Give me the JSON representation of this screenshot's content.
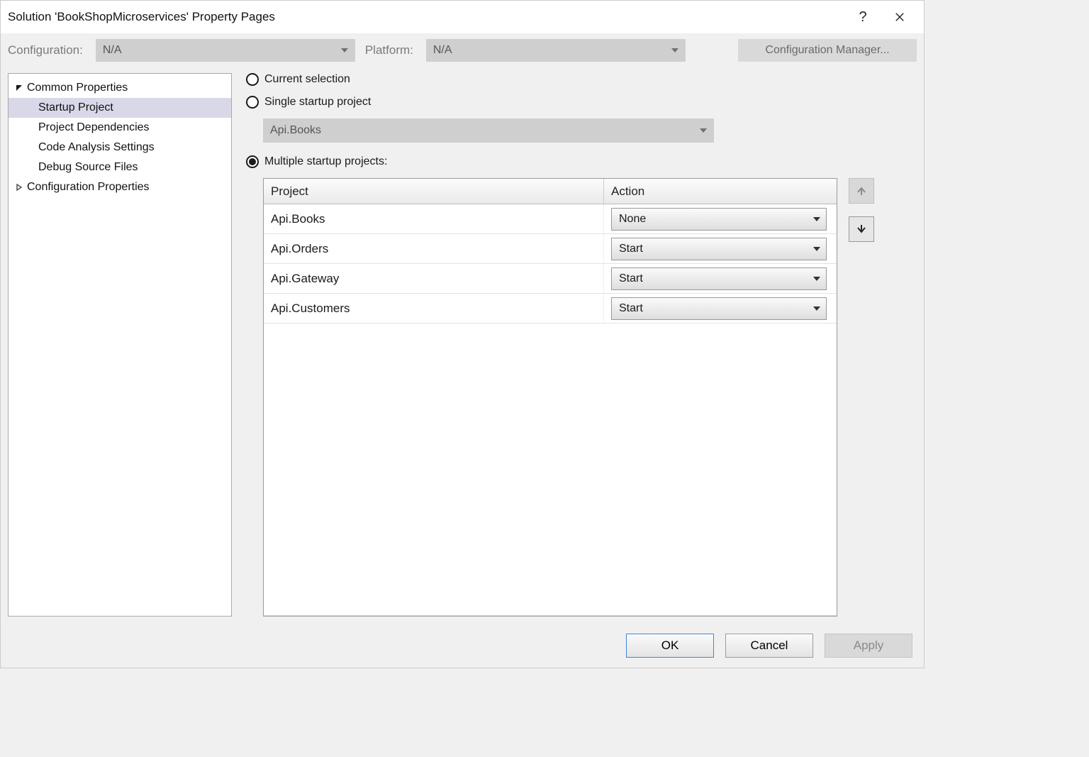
{
  "window": {
    "title": "Solution 'BookShopMicroservices' Property Pages"
  },
  "configRow": {
    "configLabel": "Configuration:",
    "configValue": "N/A",
    "platformLabel": "Platform:",
    "platformValue": "N/A",
    "managerButton": "Configuration Manager..."
  },
  "tree": {
    "root1": "Common Properties",
    "root1_children": [
      "Startup Project",
      "Project Dependencies",
      "Code Analysis Settings",
      "Debug Source Files"
    ],
    "root2": "Configuration Properties"
  },
  "content": {
    "radio_current": "Current selection",
    "radio_single": "Single startup project",
    "single_value": "Api.Books",
    "radio_multiple": "Multiple startup projects:",
    "grid": {
      "header_project": "Project",
      "header_action": "Action",
      "rows": [
        {
          "project": "Api.Books",
          "action": "None"
        },
        {
          "project": "Api.Orders",
          "action": "Start"
        },
        {
          "project": "Api.Gateway",
          "action": "Start"
        },
        {
          "project": "Api.Customers",
          "action": "Start"
        }
      ]
    }
  },
  "footer": {
    "ok": "OK",
    "cancel": "Cancel",
    "apply": "Apply"
  }
}
